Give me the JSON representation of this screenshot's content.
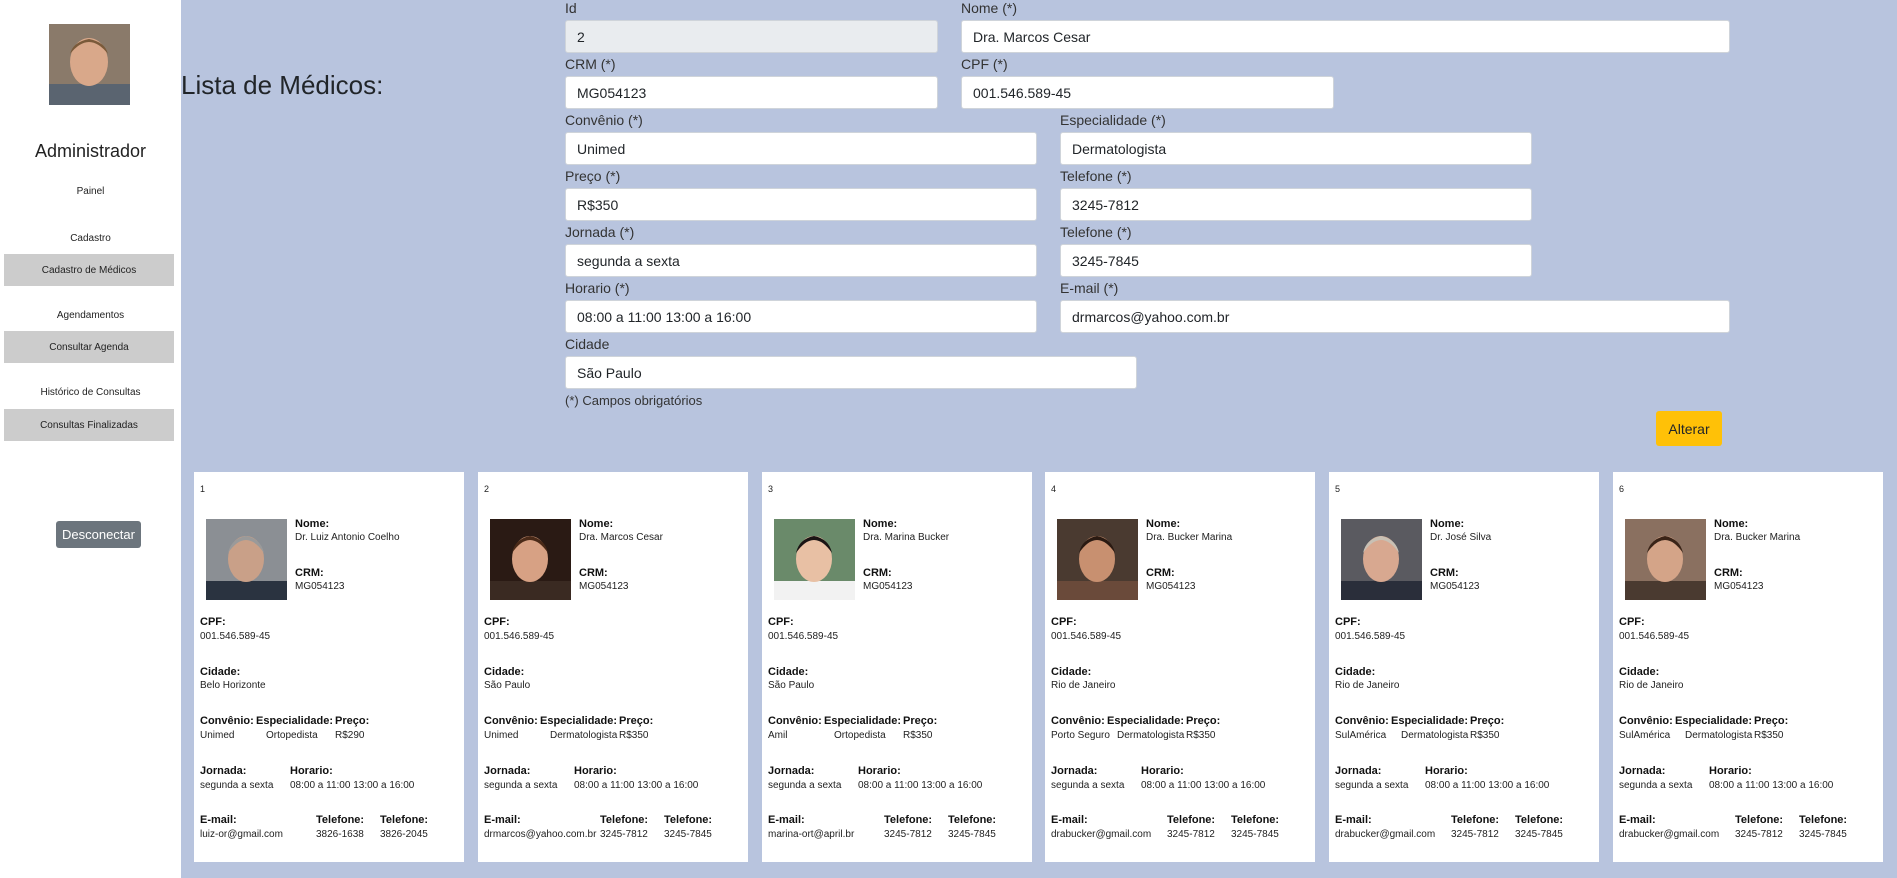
{
  "sidebar": {
    "admin_title": "Administrador",
    "painel_label": "Painel",
    "cadastro_label": "Cadastro",
    "cadastro_btn": "Cadastro de Médicos",
    "agendamentos_label": "Agendamentos",
    "agenda_btn": "Consultar Agenda",
    "historico_label": "Histórico de Consultas",
    "finalizadas_btn": "Consultas Finalizadas",
    "logout_btn": "Desconectar"
  },
  "page_title": "Lista de Médicos:",
  "form": {
    "id_label": "Id",
    "id_value": "2",
    "nome_label": "Nome (*)",
    "nome_value": "Dra. Marcos Cesar",
    "crm_label": "CRM (*)",
    "crm_value": "MG054123",
    "cpf_label": "CPF (*)",
    "cpf_value": "001.546.589-45",
    "convenio_label": "Convênio (*)",
    "convenio_value": "Unimed",
    "especialidade_label": "Especialidade (*)",
    "especialidade_value": "Dermatologista",
    "preco_label": "Preço (*)",
    "preco_value": "R$350",
    "telefone1_label": "Telefone (*)",
    "telefone1_value": "3245-7812",
    "jornada_label": "Jornada (*)",
    "jornada_value": "segunda a sexta",
    "telefone2_label": "Telefone (*)",
    "telefone2_value": "3245-7845",
    "horario_label": "Horario (*)",
    "horario_value": "08:00 a 11:00 13:00 a 16:00",
    "email_label": "E-mail (*)",
    "email_value": "drmarcos@yahoo.com.br",
    "cidade_label": "Cidade",
    "cidade_value": "São Paulo",
    "required_note": "(*) Campos obrigatórios",
    "submit_btn": "Alterar"
  },
  "card_labels": {
    "nome": "Nome:",
    "crm": "CRM:",
    "cpf": "CPF:",
    "cidade": "Cidade:",
    "convenio": "Convênio:",
    "especialidade": "Especialidade:",
    "preco": "Preço:",
    "jornada": "Jornada:",
    "horario": "Horario:",
    "email": "E-mail:",
    "telefone1": "Telefone:",
    "telefone2": "Telefone:"
  },
  "cards": [
    {
      "id": "1",
      "nome": "Dr. Luiz Antonio Coelho",
      "crm": "MG054123",
      "cpf": "001.546.589-45",
      "cidade": "Belo Horizonte",
      "convenio": "Unimed",
      "especialidade": "Ortopedista",
      "preco": "R$290",
      "jornada": "segunda a sexta",
      "horario": "08:00 a 11:00 13:00 a 16:00",
      "email": "luiz-or@gmail.com",
      "telefone1": "3826-1638",
      "telefone2": "3826-2045"
    },
    {
      "id": "2",
      "nome": "Dra. Marcos Cesar",
      "crm": "MG054123",
      "cpf": "001.546.589-45",
      "cidade": "São Paulo",
      "convenio": "Unimed",
      "especialidade": "Dermatologista",
      "preco": "R$350",
      "jornada": "segunda a sexta",
      "horario": "08:00 a 11:00 13:00 a 16:00",
      "email": "drmarcos@yahoo.com.br",
      "telefone1": "3245-7812",
      "telefone2": "3245-7845"
    },
    {
      "id": "3",
      "nome": "Dra. Marina Bucker",
      "crm": "MG054123",
      "cpf": "001.546.589-45",
      "cidade": "São Paulo",
      "convenio": "Amil",
      "especialidade": "Ortopedista",
      "preco": "R$350",
      "jornada": "segunda a sexta",
      "horario": "08:00 a 11:00 13:00 a 16:00",
      "email": "marina-ort@april.br",
      "telefone1": "3245-7812",
      "telefone2": "3245-7845"
    },
    {
      "id": "4",
      "nome": "Dra. Bucker Marina",
      "crm": "MG054123",
      "cpf": "001.546.589-45",
      "cidade": "Rio de Janeiro",
      "convenio": "Porto Seguro",
      "especialidade": "Dermatologista",
      "preco": "R$350",
      "jornada": "segunda a sexta",
      "horario": "08:00 a 11:00 13:00 a 16:00",
      "email": "drabucker@gmail.com",
      "telefone1": "3245-7812",
      "telefone2": "3245-7845"
    },
    {
      "id": "5",
      "nome": "Dr. José Silva",
      "crm": "MG054123",
      "cpf": "001.546.589-45",
      "cidade": "Rio de Janeiro",
      "convenio": "SulAmérica",
      "especialidade": "Dermatologista",
      "preco": "R$350",
      "jornada": "segunda a sexta",
      "horario": "08:00 a 11:00 13:00 a 16:00",
      "email": "drabucker@gmail.com",
      "telefone1": "3245-7812",
      "telefone2": "3245-7845"
    },
    {
      "id": "6",
      "nome": "Dra. Bucker Marina",
      "crm": "MG054123",
      "cpf": "001.546.589-45",
      "cidade": "Rio de Janeiro",
      "convenio": "SulAmérica",
      "especialidade": "Dermatologista",
      "preco": "R$350",
      "jornada": "segunda a sexta",
      "horario": "08:00 a 11:00 13:00 a 16:00",
      "email": "drabucker@gmail.com",
      "telefone1": "3245-7812",
      "telefone2": "3245-7845"
    }
  ]
}
